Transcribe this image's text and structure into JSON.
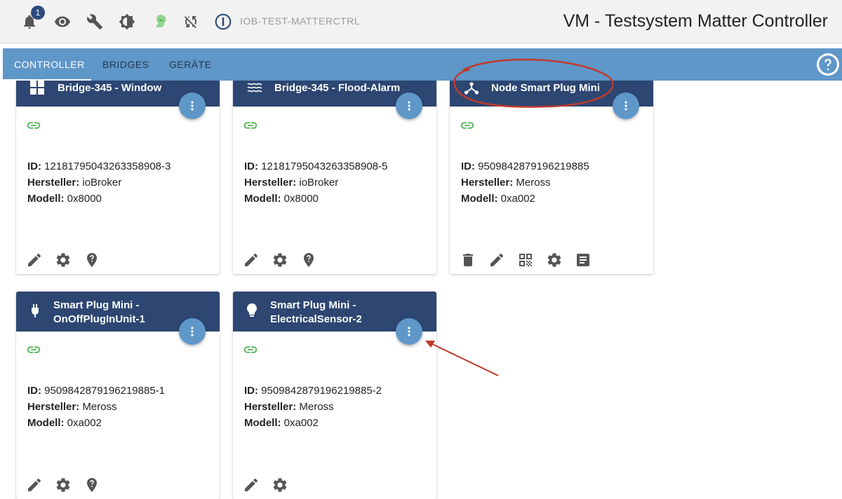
{
  "topbar": {
    "notifications_count": "1",
    "instance_name": "IOB-TEST-MATTERCTRL",
    "title": "VM - Testsystem Matter Controller",
    "icons": [
      "bell-icon",
      "eye-icon",
      "wrench-icon",
      "brightness-icon",
      "user-status-icon",
      "sync-off-icon",
      "iobroker-logo"
    ]
  },
  "tabs": [
    {
      "label": "CONTROLLER",
      "active": true
    },
    {
      "label": "BRIDGES",
      "active": false
    },
    {
      "label": "GERÄTE",
      "active": false
    }
  ],
  "labels": {
    "id": "ID:",
    "manufacturer": "Hersteller:",
    "model": "Modell:"
  },
  "cards": [
    {
      "title": "Bridge-345 - Window",
      "icon": "window-icon",
      "id": "12181795043263358908-3",
      "manufacturer": "ioBroker",
      "model": "0x8000",
      "actions": [
        "edit-icon",
        "settings-icon",
        "identify-icon"
      ]
    },
    {
      "title": "Bridge-345 - Flood-Alarm",
      "icon": "waves-icon",
      "id": "12181795043263358908-5",
      "manufacturer": "ioBroker",
      "model": "0x8000",
      "actions": [
        "edit-icon",
        "settings-icon",
        "identify-icon"
      ]
    },
    {
      "title": "Node Smart Plug Mini",
      "icon": "node-hub-icon",
      "id": "9509842879196219885",
      "manufacturer": "Meross",
      "model": "0xa002",
      "actions": [
        "delete-icon",
        "edit-icon",
        "qr-code-icon",
        "settings-icon",
        "log-icon"
      ]
    },
    {
      "title": "Smart Plug Mini - OnOffPlugInUnit-1",
      "icon": "plug-icon",
      "id": "9509842879196219885-1",
      "manufacturer": "Meross",
      "model": "0xa002",
      "actions": [
        "edit-icon",
        "settings-icon",
        "identify-icon"
      ]
    },
    {
      "title": "Smart Plug Mini - ElectricalSensor-2",
      "icon": "bulb-icon",
      "id": "9509842879196219885-2",
      "manufacturer": "Meross",
      "model": "0xa002",
      "actions": [
        "edit-icon",
        "settings-icon"
      ]
    }
  ],
  "colors": {
    "header": "#2d4672",
    "tabbar": "#5f97c9",
    "fab": "#5f97c9",
    "link": "#4caf50",
    "annotation": "#c0392b"
  }
}
